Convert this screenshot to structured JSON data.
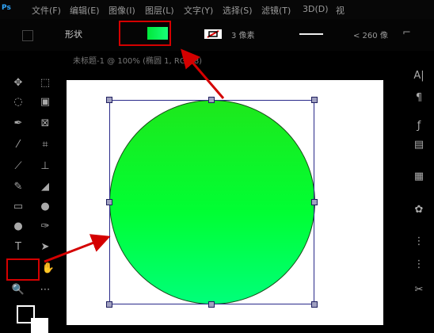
{
  "app": {
    "logo": "Ps"
  },
  "menu": [
    {
      "label": "文件(F)"
    },
    {
      "label": "编辑(E)"
    },
    {
      "label": "图像(I)"
    },
    {
      "label": "图层(L)"
    },
    {
      "label": "文字(Y)"
    },
    {
      "label": "选择(S)"
    },
    {
      "label": "滤镜(T)"
    },
    {
      "label": "3D(D)"
    },
    {
      "label": "视"
    }
  ],
  "options": {
    "mode": "形状",
    "stroke_width": "3 像素",
    "width_value": "< 260 像",
    "fill_color": "#00ff44"
  },
  "document": {
    "tab": "未标题-1 @ 100% (椭圆 1, RGB/8)"
  },
  "colors": {
    "foreground": "#000000",
    "background": "#ffffff",
    "highlight": "#d40000"
  }
}
